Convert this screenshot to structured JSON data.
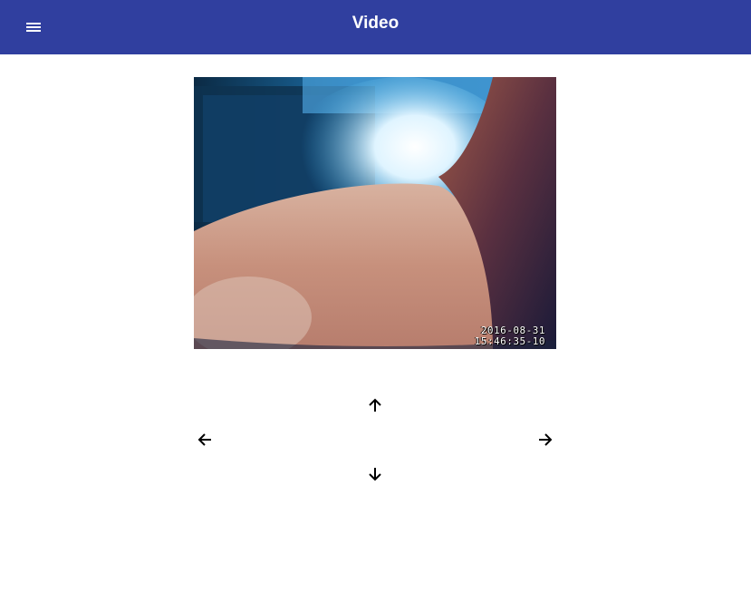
{
  "appbar": {
    "title": "Video",
    "color": "#303f9f",
    "menu_icon": "hamburger-menu-icon"
  },
  "video": {
    "timestamp_date": "2016-08-31",
    "timestamp_time": "15:46:35-10"
  },
  "controls": {
    "up_icon": "arrow-up-icon",
    "left_icon": "arrow-left-icon",
    "right_icon": "arrow-right-icon",
    "down_icon": "arrow-down-icon"
  }
}
